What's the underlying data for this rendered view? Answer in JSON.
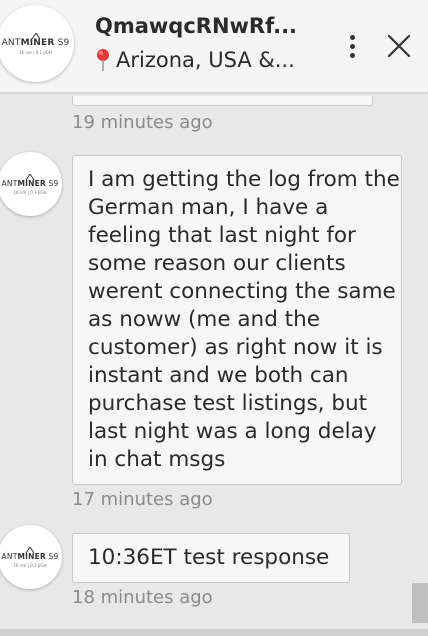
{
  "header": {
    "title": "QmawqcRNwRf...",
    "location": "Arizona, USA &...",
    "avatar_logo": {
      "brand_prefix": "ANT",
      "brand_bold": "MINER",
      "model": "S9",
      "spec": "16 nm | 0.1 J/GH"
    }
  },
  "messages": [
    {
      "text": "I am getting the log from the German man, I have a feeling that last night for some reason our clients werent connecting the same as noww (me and the customer) as right now it is instant and we both can purchase test listings, but last night was a long delay in chat msgs",
      "time": "17 minutes ago"
    },
    {
      "text": "10:36ET test response",
      "time": "18 minutes ago"
    }
  ],
  "previous_message_time": "19 minutes ago",
  "icons": {
    "pin": "location-pin-icon",
    "menu": "more-vertical-icon",
    "close": "close-icon"
  },
  "colors": {
    "pin": "#e53935",
    "timestamp": "#8a8a8a",
    "bubble_bg": "#f7f7f7"
  }
}
